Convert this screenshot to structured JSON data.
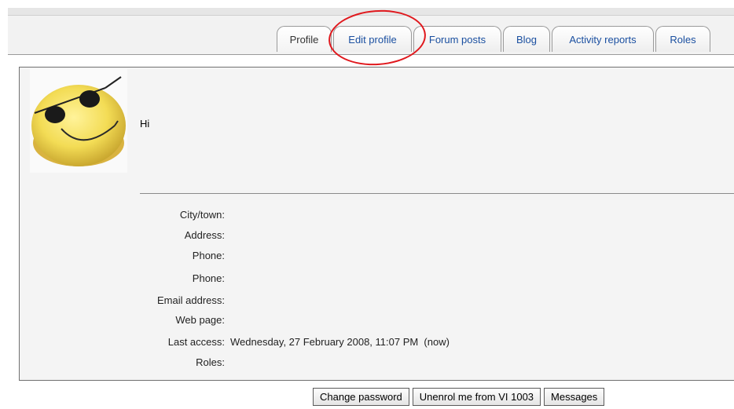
{
  "tabs": [
    {
      "label": "Profile",
      "active": true
    },
    {
      "label": "Edit profile",
      "active": false
    },
    {
      "label": "Forum posts",
      "active": false
    },
    {
      "label": "Blog",
      "active": false
    },
    {
      "label": "Activity reports",
      "active": false
    },
    {
      "label": "Roles",
      "active": false
    }
  ],
  "profile": {
    "description": "Hi",
    "fields": [
      {
        "label": "City/town:",
        "value": ""
      },
      {
        "label": "Address:",
        "value": ""
      },
      {
        "label": "Phone:",
        "value": ""
      },
      {
        "label": "Phone:",
        "value": ""
      },
      {
        "label": "Email address:",
        "value": ""
      },
      {
        "label": "Web page:",
        "value": ""
      },
      {
        "label": "Last access:",
        "value": "Wednesday, 27 February 2008, 11:07 PM  (now)"
      },
      {
        "label": "Roles:",
        "value": ""
      }
    ]
  },
  "buttons": {
    "change_password": "Change password",
    "unenrol": "Unenrol me from VI 1003",
    "messages": "Messages"
  },
  "colors": {
    "tab_link": "#1a4fa0",
    "highlight": "#e0181d"
  }
}
